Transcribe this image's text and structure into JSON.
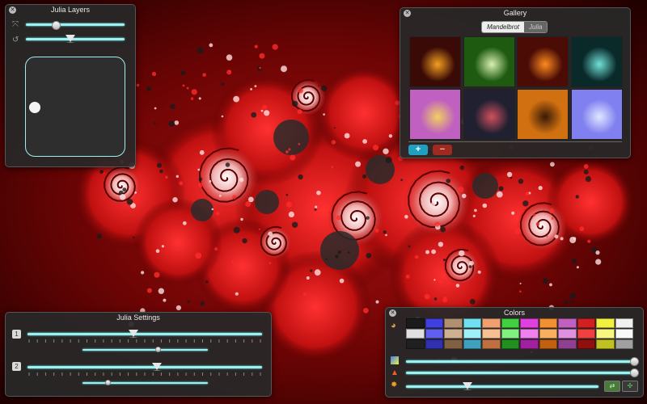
{
  "julia_layers": {
    "title": "Julia Layers",
    "slider1": 0.3,
    "slider2": 0.45
  },
  "gallery": {
    "title": "Gallery",
    "tabs": [
      "Mandelbrot",
      "Julia"
    ],
    "selected_tab": "Mandelbrot",
    "add_button": "+",
    "remove_button": "−",
    "thumbnails": [
      {
        "bg": "#3a0a06",
        "accent": "#f2a020"
      },
      {
        "bg": "#1e5a10",
        "accent": "#d8f0b0"
      },
      {
        "bg": "#4a0c05",
        "accent": "#ff8a20"
      },
      {
        "bg": "#0a2a2a",
        "accent": "#70e0d8"
      },
      {
        "bg": "#c060c0",
        "accent": "#f0d060"
      },
      {
        "bg": "#202030",
        "accent": "#d05060"
      },
      {
        "bg": "#d07010",
        "accent": "#3a1a08"
      },
      {
        "bg": "#8080f0",
        "accent": "#e0e8ff"
      }
    ]
  },
  "julia_settings": {
    "title": "Julia Settings",
    "row1_label": "1",
    "row2_label": "2",
    "row1_main": 0.45,
    "row1_sub": 0.6,
    "row2_main": 0.55,
    "row2_sub": 0.2
  },
  "colors": {
    "title": "Colors",
    "palette": [
      [
        "#1a1a1a",
        "#4040e0",
        "#b09070",
        "#70e0f0",
        "#f0a070",
        "#40d040",
        "#e040e0",
        "#f09030",
        "#c060c0",
        "#d02020",
        "#f0f040",
        "#f0f0f0"
      ],
      [
        "#e0e0e0",
        "#6060f0",
        "#d0b090",
        "#a0f0f8",
        "#f8c090",
        "#80f080",
        "#f080f0",
        "#f8b060",
        "#e090e0",
        "#f04040",
        "#f8f880",
        "#f8f8f8"
      ],
      [
        "#202020",
        "#3030b0",
        "#806040",
        "#40a0c0",
        "#c07040",
        "#209020",
        "#a020a0",
        "#c06010",
        "#904090",
        "#901010",
        "#c0c020",
        "#a0a0a0"
      ]
    ],
    "slider1": 1.0,
    "slider2": 1.0,
    "slider3": 0.32
  }
}
